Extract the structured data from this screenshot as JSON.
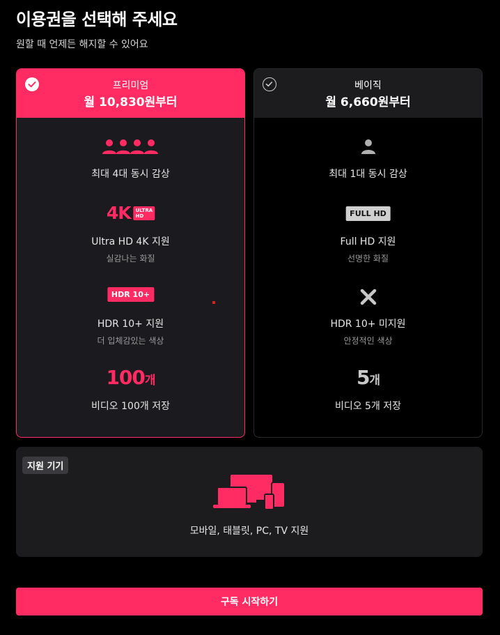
{
  "header": {
    "title": "이용권을 선택해 주세요",
    "subtitle": "원할 때 언제든 해지할 수 있어요"
  },
  "plans": [
    {
      "name": "프리미엄",
      "price": "월 10,830원부터",
      "selected": true,
      "features": [
        {
          "icon": "four-people-icon",
          "main": "최대 4대 동시 감상",
          "sub": ""
        },
        {
          "icon": "4k-ultra-hd-badge",
          "badge_big": "4K",
          "badge_small_1": "ULTRA",
          "badge_small_2": "HD",
          "main": "Ultra HD 4K 지원",
          "sub": "실감나는 화질"
        },
        {
          "icon": "hdr10plus-badge",
          "badge": "HDR 10+",
          "main": "HDR 10+ 지원",
          "sub": "더 입체감있는 색상"
        },
        {
          "count": "100",
          "unit": "개",
          "main": "비디오 100개 저장",
          "sub": ""
        }
      ]
    },
    {
      "name": "베이직",
      "price": "월 6,660원부터",
      "selected": false,
      "features": [
        {
          "icon": "single-person-icon",
          "main": "최대 1대 동시 감상",
          "sub": ""
        },
        {
          "icon": "full-hd-badge",
          "badge": "FULL HD",
          "main": "Full HD 지원",
          "sub": "선명한 화질"
        },
        {
          "icon": "x-icon",
          "main": "HDR 10+ 미지원",
          "sub": "안정적인 색상"
        },
        {
          "count": "5",
          "unit": "개",
          "main": "비디오 5개 저장",
          "sub": ""
        }
      ]
    }
  ],
  "devices": {
    "tag": "지원 기기",
    "icon": "devices-icon",
    "text": "모바일, 태블릿, PC, TV 지원"
  },
  "cta": {
    "label": "구독 시작하기"
  },
  "colors": {
    "accent": "#ff2b62",
    "background": "#000000",
    "panel": "#1c1c1f"
  }
}
